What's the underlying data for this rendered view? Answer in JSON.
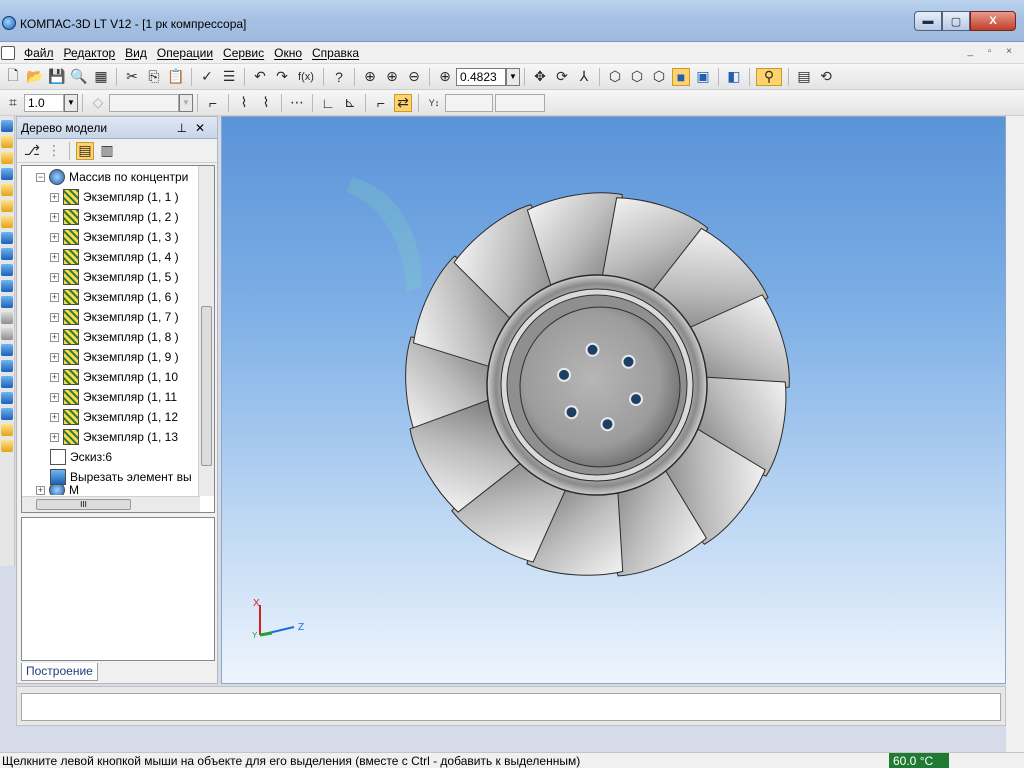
{
  "window": {
    "title": "КОМПАС-3D LT V12 - [1 рк компрессора]",
    "minimize": "▬",
    "maximize": "▢",
    "close": "X"
  },
  "menu": [
    "Файл",
    "Редактор",
    "Вид",
    "Операции",
    "Сервис",
    "Окно",
    "Справка"
  ],
  "toolbar": {
    "zoom_value": "0.4823",
    "fx_label": "f(x)",
    "scale_value": "1.0"
  },
  "model_tree": {
    "header": "Дерево модели",
    "pin": "ᵖ",
    "close": "✕",
    "array_label": "Массив по концентри",
    "instances": [
      "Экземпляр (1, 1 )",
      "Экземпляр (1, 2 )",
      "Экземпляр (1, 3 )",
      "Экземпляр (1, 4 )",
      "Экземпляр (1, 5 )",
      "Экземпляр (1, 6 )",
      "Экземпляр (1, 7 )",
      "Экземпляр (1, 8 )",
      "Экземпляр (1, 9 )",
      "Экземпляр (1, 10",
      "Экземпляр (1, 11",
      "Экземпляр (1, 12",
      "Экземпляр (1, 13"
    ],
    "sketch": "Эскиз:6",
    "cut": "Вырезать элемент вы",
    "partial": "М",
    "tab": "Построение"
  },
  "axes": {
    "x": "X",
    "y": "Y",
    "z": "Z"
  },
  "status": {
    "message": "Щелкните левой кнопкой мыши на объекте для его выделения (вместе с Ctrl - добавить к выделенным)",
    "temperature": "60.0 °C"
  }
}
